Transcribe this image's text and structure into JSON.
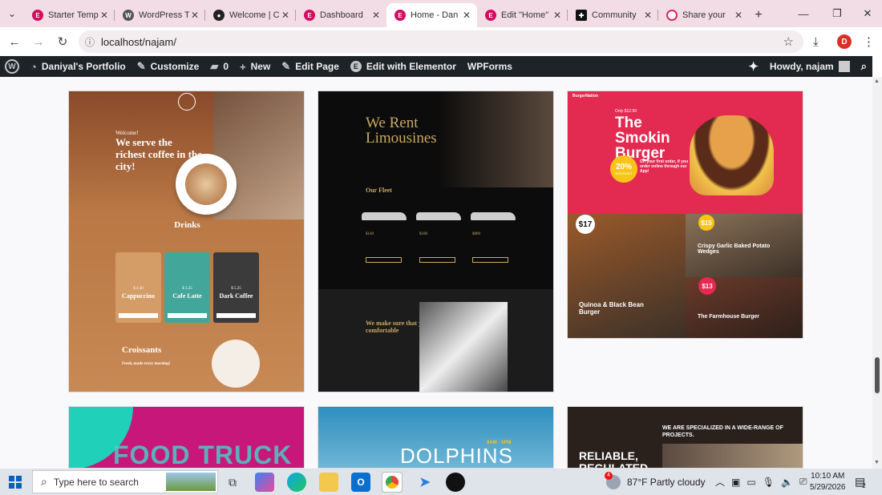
{
  "browser": {
    "tabs": [
      {
        "title": "Starter Temp",
        "icon": "elementor-icon",
        "color": "#d30c5c"
      },
      {
        "title": "WordPress T",
        "icon": "wordpress-icon",
        "color": "#555555"
      },
      {
        "title": "Welcome | C",
        "icon": "github-icon",
        "color": "#222222"
      },
      {
        "title": "Dashboard",
        "icon": "elementor-icon",
        "color": "#d30c5c"
      },
      {
        "title": "Home - Dan",
        "icon": "elementor-icon",
        "color": "#d30c5c",
        "active": true
      },
      {
        "title": "Edit \"Home\"",
        "icon": "elementor-icon",
        "color": "#d30c5c"
      },
      {
        "title": "Community",
        "icon": "community-icon",
        "color": "#111111"
      },
      {
        "title": "Share your",
        "icon": "chat-icon",
        "color": "#e0245e"
      }
    ],
    "new_tab": "+",
    "url": "localhost/najam/",
    "profile_initial": "D"
  },
  "adminbar": {
    "site_name": "Daniyal's Portfolio",
    "customize": "Customize",
    "comments_count": "0",
    "new": "New",
    "edit_page": "Edit Page",
    "edit_elementor": "Edit with Elementor",
    "wpforms": "WPForms",
    "howdy": "Howdy, najam"
  },
  "templates": {
    "coffee": {
      "welcome": "Welcome!",
      "headline": "We serve the richest coffee in the city!",
      "drinks": "Drinks",
      "items": [
        {
          "price": "$ 4.50",
          "name": "Cappuccino"
        },
        {
          "price": "$ 3.25",
          "name": "Cafe Latte"
        },
        {
          "price": "$ 5.25",
          "name": "Dark Coffee"
        }
      ],
      "croissants": "Croissants",
      "fresh": "Fresh, made every morning!"
    },
    "limo": {
      "headline": "We Rent Limousines",
      "fleet": "Our Fleet",
      "prices": [
        "$140",
        "$180",
        "$800"
      ],
      "comfort": "We make sure that your every trip is comfortable"
    },
    "burger": {
      "brand": "BurgerNation",
      "only": "Only $12.99",
      "headline": "The Smokin Burger",
      "discount": "20%",
      "discount_label": "DISCOUNT",
      "offer": "On your first order, if you order online through our App!",
      "price1": "$17",
      "price2": "$15",
      "wedges": "Crispy Garlic Baked Potato Wedges",
      "quinoa": "Quinoa & Black Bean Burger",
      "price3": "$13",
      "farmhouse": "The Farmhouse Burger"
    },
    "foodtruck": {
      "headline": "FOOD TRUCK"
    },
    "dolphins": {
      "headline": "DOLPHINS",
      "times": "9AM - 5PM"
    },
    "reliable": {
      "headline": "RELIABLE, REGULATED",
      "tagline": "WE ARE SPECIALIZED IN A WIDE-RANGE OF PROJECTS."
    }
  },
  "taskbar": {
    "search_placeholder": "Type here to search",
    "weather": "87°F  Partly cloudy",
    "weather_badge": "4",
    "time": "10:10 AM",
    "date": "5/29/2026",
    "notif_count": "2"
  }
}
